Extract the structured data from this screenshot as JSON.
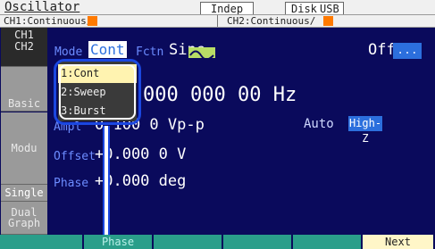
{
  "header": {
    "title": "Oscillator",
    "indep": "Indep",
    "disk": "Disk",
    "usb": "USB",
    "ch1_status": "CH1:Continuous/",
    "ch2_status": "CH2:Continuous/"
  },
  "sidebar": {
    "tabs": [
      {
        "label": "CH1\nCH2"
      },
      {
        "label": "Basic"
      },
      {
        "label": "Modu"
      },
      {
        "label": "Single"
      },
      {
        "label": "Dual\nGraph"
      }
    ]
  },
  "params": {
    "mode_label": "Mode",
    "mode_value": "Cont",
    "fctn_label": "Fctn",
    "fctn_value": "Sine",
    "output": "Off",
    "output_more": "...",
    "freq_value": "000 000 00 Hz",
    "ampl_label": "Ampl",
    "ampl_value": "0.100 0 Vp-p",
    "auto_label": "Auto",
    "highz": "High-Z",
    "offset_label": "Offset",
    "offset_value": "+0.000 0 V",
    "phase_label": "Phase",
    "phase_value": "+0.000 deg"
  },
  "dropdown": {
    "items": [
      "1:Cont",
      "2:Sweep",
      "3:Burst"
    ],
    "selected_index": 0
  },
  "function_keys": {
    "phase": "Phase",
    "next": "Next"
  },
  "colors": {
    "panel_bg": "#0a0a5c",
    "accent_blue": "#2c6fdd",
    "callout": "#1b47e0",
    "highlight_yellow": "#fff3b0",
    "fkey_teal": "#2a9e8a",
    "channel_orange": "#ff7a00",
    "sine_green": "#b8dd66"
  }
}
